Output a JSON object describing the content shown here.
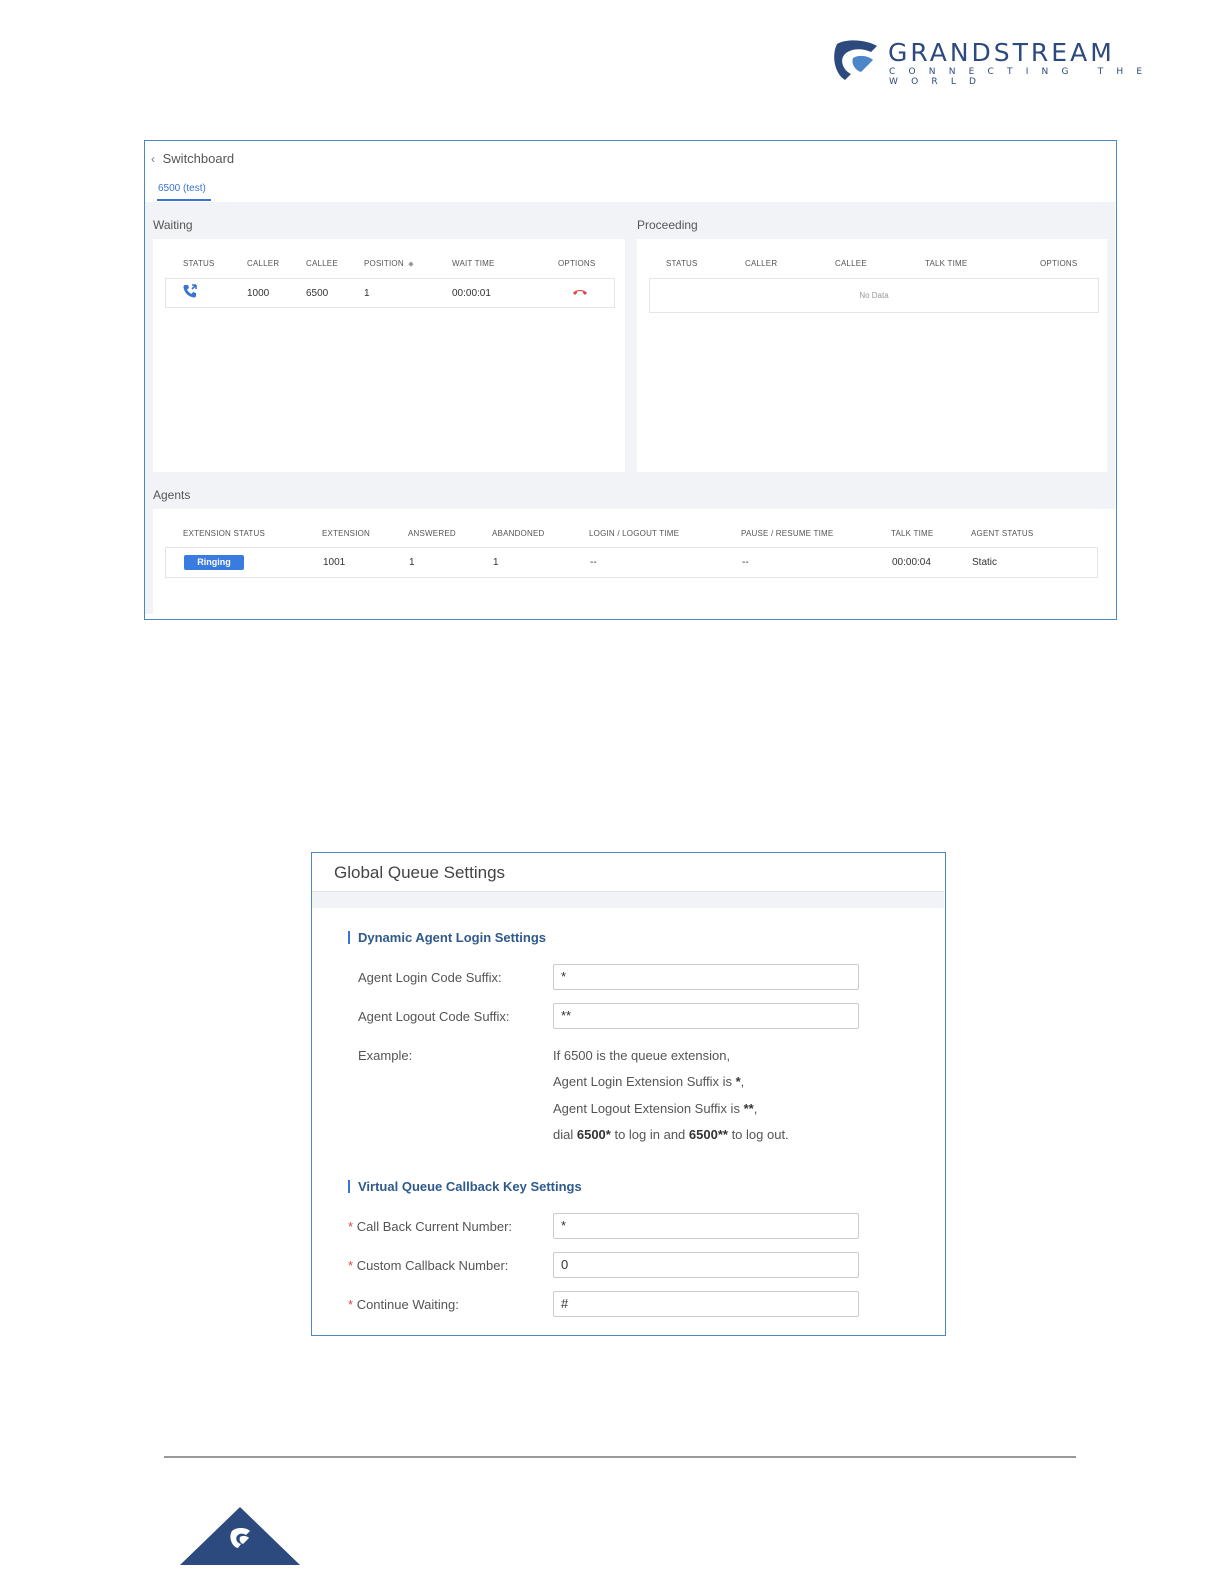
{
  "brand": {
    "name": "GRANDSTREAM",
    "tagline": "CONNECTING THE WORLD"
  },
  "switchboard": {
    "back_label": "Switchboard",
    "tab_label": "6500 (test)",
    "waiting": {
      "title": "Waiting",
      "columns": [
        "STATUS",
        "CALLER",
        "CALLEE",
        "POSITION",
        "WAIT TIME",
        "OPTIONS"
      ],
      "rows": [
        {
          "caller": "1000",
          "callee": "6500",
          "position": "1",
          "wait_time": "00:00:01"
        }
      ]
    },
    "proceeding": {
      "title": "Proceeding",
      "columns": [
        "STATUS",
        "CALLER",
        "CALLEE",
        "TALK TIME",
        "OPTIONS"
      ],
      "empty_text": "No Data"
    },
    "agents": {
      "title": "Agents",
      "columns": [
        "EXTENSION STATUS",
        "EXTENSION",
        "ANSWERED",
        "ABANDONED",
        "LOGIN / LOGOUT TIME",
        "PAUSE / RESUME TIME",
        "TALK TIME",
        "AGENT STATUS"
      ],
      "rows": [
        {
          "extension_status": "Ringing",
          "extension": "1001",
          "answered": "1",
          "abandoned": "1",
          "login_logout": "--",
          "pause_resume": "--",
          "talk_time": "00:00:04",
          "agent_status": "Static"
        }
      ]
    }
  },
  "global_queue": {
    "title": "Global Queue Settings",
    "dynamic_section": "Dynamic Agent Login Settings",
    "login_label": "Agent Login Code Suffix:",
    "login_value": "*",
    "logout_label": "Agent Logout Code Suffix:",
    "logout_value": "**",
    "example_label": "Example:",
    "example_line1": "If 6500 is the queue extension,",
    "example_line2_pre": "Agent Login Extension Suffix is ",
    "example_line2_bold": "*",
    "example_line2_post": ",",
    "example_line3_pre": "Agent Logout Extension Suffix is ",
    "example_line3_bold": "**",
    "example_line3_post": ",",
    "example_line4_a": "dial ",
    "example_line4_b": "6500*",
    "example_line4_c": " to log in and ",
    "example_line4_d": "6500**",
    "example_line4_e": " to log out.",
    "virtual_section": "Virtual Queue Callback Key Settings",
    "required_mark": "*",
    "callback_current_label": "Call Back Current Number:",
    "callback_current_value": "*",
    "custom_callback_label": "Custom Callback Number:",
    "custom_callback_value": "0",
    "continue_waiting_label": "Continue Waiting:",
    "continue_waiting_value": "#"
  },
  "colors": {
    "accent": "#3a73d0",
    "brand": "#2c4a7e",
    "hangup": "#e04646"
  }
}
